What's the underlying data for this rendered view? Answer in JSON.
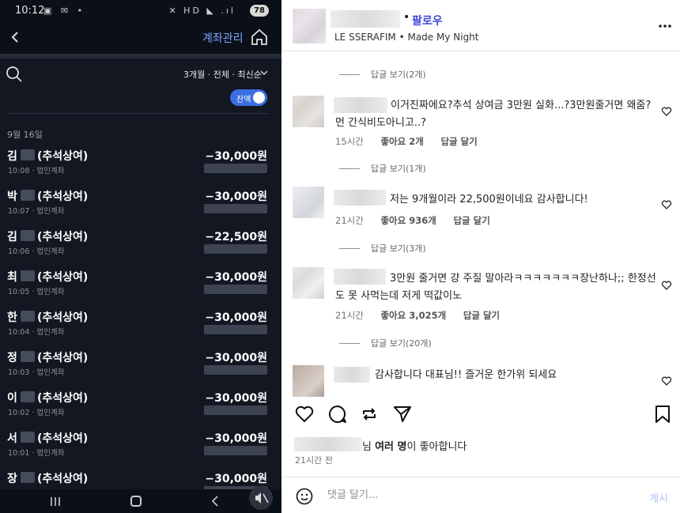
{
  "left_app": {
    "status_bar": {
      "time": "10:12",
      "battery": "78",
      "left_icons": "▣ ✉ •",
      "right_icons": "✕ HD ◣ .ıl"
    },
    "header": {
      "title": "계좌관리"
    },
    "filter": {
      "label": "3개월 · 전체 · 최신순"
    },
    "toggle": {
      "label": "잔액",
      "on": true
    },
    "date_header": "9월 16일",
    "transactions": [
      {
        "surname": "김",
        "memo": "(추석상여)",
        "amount": "−30,000원",
        "time": "10:08",
        "account": "법인계좌"
      },
      {
        "surname": "박",
        "memo": "(추석상여)",
        "amount": "−30,000원",
        "time": "10:07",
        "account": "법인계좌"
      },
      {
        "surname": "김",
        "memo": "(추석상여)",
        "amount": "−22,500원",
        "time": "10:06",
        "account": "법인계좌"
      },
      {
        "surname": "최",
        "memo": "(추석상여)",
        "amount": "−30,000원",
        "time": "10:05",
        "account": "법인계좌"
      },
      {
        "surname": "한",
        "memo": "(추석상여)",
        "amount": "−30,000원",
        "time": "10:04",
        "account": "법인계좌"
      },
      {
        "surname": "정",
        "memo": "(추석상여)",
        "amount": "−30,000원",
        "time": "10:03",
        "account": "법인계좌"
      },
      {
        "surname": "이",
        "memo": "(추석상여)",
        "amount": "−30,000원",
        "time": "10:02",
        "account": "법인계좌"
      },
      {
        "surname": "서",
        "memo": "(추석상여)",
        "amount": "−30,000원",
        "time": "10:01",
        "account": "법인계좌"
      },
      {
        "surname": "장",
        "memo": "(추석상여)",
        "amount": "−30,000원",
        "time": "10:00",
        "account": "법인계좌"
      }
    ]
  },
  "right_app": {
    "header": {
      "dot": "•",
      "follow": "팔로우",
      "subtitle": "LE SSERAFIM • Made My Night"
    },
    "view_replies": [
      "답글 보기(2개)",
      "답글 보기(1개)",
      "답글 보기(3개)",
      "답글 보기(20개)"
    ],
    "comments": [
      {
        "text": "이거진짜에요?추석 상여금 3만원 실화...?3만원줄거면 왜줌? 먼 간식비도아니고..?",
        "time": "15시간",
        "likes": "좋아요 2개",
        "reply": "답글 달기"
      },
      {
        "text": "저는 9개월이라 22,500원이네요 감사합니다!",
        "time": "21시간",
        "likes": "좋아요 936개",
        "reply": "답글 달기"
      },
      {
        "text": "3만원 줄거면 걍 주질 말아라ㅋㅋㅋㅋㅋㅋㅋ장난하나;; 한정선도 못 사먹는데 저게 떡값이노",
        "time": "21시간",
        "likes": "좋아요 3,025개",
        "reply": "답글 달기"
      },
      {
        "text": "감사합니다 대표님!! 즐거운 한가위 되세요",
        "time": "",
        "likes": "",
        "reply": ""
      }
    ],
    "liked_by": {
      "prefix": "님 ",
      "bold": "여러 명",
      "suffix": "이 좋아합니다"
    },
    "post_time": "21시간 전",
    "comment_box": {
      "placeholder": "댓글 달기...",
      "post_label": "게시"
    }
  }
}
